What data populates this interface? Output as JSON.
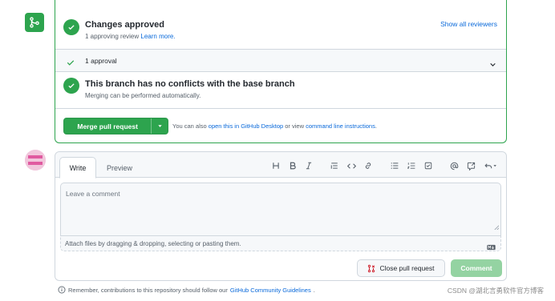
{
  "merge_box": {
    "approved": {
      "title": "Changes approved",
      "subtitle_prefix": "1 approving review",
      "learn_more": "Learn more.",
      "show_all": "Show all reviewers"
    },
    "approval_summary": "1 approval",
    "conflicts": {
      "title": "This branch has no conflicts with the base branch",
      "subtitle": "Merging can be performed automatically."
    },
    "merge_button_label": "Merge pull request",
    "also_text_1": "You can also",
    "desktop_link": "open this in GitHub Desktop",
    "also_text_2": "or view",
    "cli_link": "command line instructions",
    "also_text_end": "."
  },
  "comment_box": {
    "tabs": {
      "write": "Write",
      "preview": "Preview"
    },
    "toolbar": [
      "heading-icon",
      "bold-icon",
      "italic-icon",
      "quote-icon",
      "code-icon",
      "link-icon",
      "bulleted-list-icon",
      "numbered-list-icon",
      "task-list-icon",
      "mention-icon",
      "reference-icon",
      "saved-replies-icon"
    ],
    "placeholder": "Leave a comment",
    "attach_text": "Attach files by dragging & dropping, selecting or pasting them.",
    "close_button": "Close pull request",
    "comment_button": "Comment"
  },
  "footer": {
    "text": "Remember, contributions to this repository should follow our",
    "link": "GitHub Community Guidelines",
    "end": "."
  },
  "watermark": "CSDN @湖北言勇软件官方博客",
  "colors": {
    "success": "#2da44e",
    "link": "#0969da",
    "danger": "#cf222e",
    "muted": "#57606a"
  }
}
